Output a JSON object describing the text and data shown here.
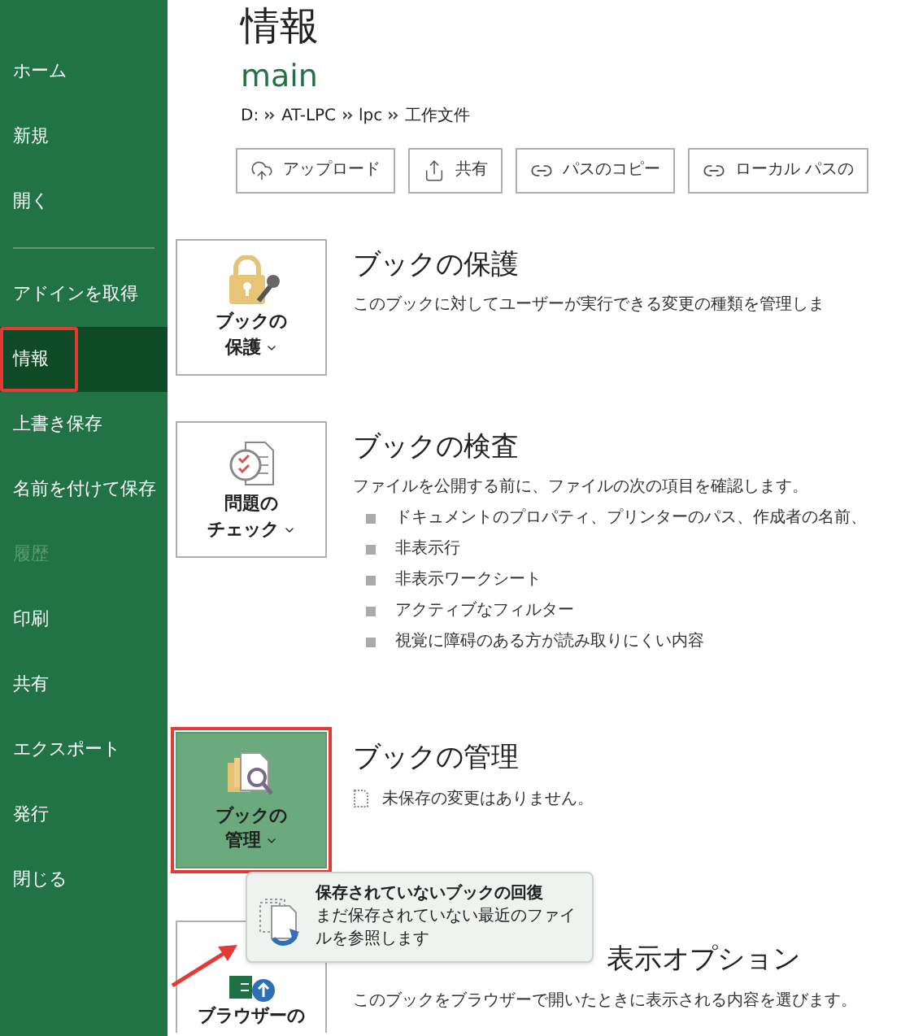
{
  "sidebar": {
    "top_items": [
      {
        "label": "ホーム",
        "selected": false,
        "disabled": false
      },
      {
        "label": "新規",
        "selected": false,
        "disabled": false
      },
      {
        "label": "開く",
        "selected": false,
        "disabled": false
      }
    ],
    "items": [
      {
        "label": "アドインを取得",
        "selected": false,
        "disabled": false,
        "highlighted": false
      },
      {
        "label": "情報",
        "selected": true,
        "disabled": false,
        "highlighted": true
      },
      {
        "label": "上書き保存",
        "selected": false,
        "disabled": false,
        "highlighted": false
      },
      {
        "label": "名前を付けて保存",
        "selected": false,
        "disabled": false,
        "highlighted": false
      },
      {
        "label": "履歴",
        "selected": false,
        "disabled": true,
        "highlighted": false
      },
      {
        "label": "印刷",
        "selected": false,
        "disabled": false,
        "highlighted": false
      },
      {
        "label": "共有",
        "selected": false,
        "disabled": false,
        "highlighted": false
      },
      {
        "label": "エクスポート",
        "selected": false,
        "disabled": false,
        "highlighted": false
      },
      {
        "label": "発行",
        "selected": false,
        "disabled": false,
        "highlighted": false
      },
      {
        "label": "閉じる",
        "selected": false,
        "disabled": false,
        "highlighted": false
      }
    ]
  },
  "page_title": "情報",
  "file": {
    "name": "main",
    "path": [
      "D:",
      "AT-LPC",
      "lpc",
      "工作文件"
    ]
  },
  "actions": [
    {
      "kind": "upload",
      "label": "アップロード"
    },
    {
      "kind": "share",
      "label": "共有"
    },
    {
      "kind": "link",
      "label": "パスのコピー"
    },
    {
      "kind": "link",
      "label": "ローカル パスの"
    }
  ],
  "sections": [
    {
      "kind": "protect",
      "button": [
        "ブックの",
        "保護"
      ],
      "active": false,
      "highlighted": false,
      "title": "ブックの保護",
      "description": "このブックに対してユーザーが実行できる変更の種類を管理しま"
    },
    {
      "kind": "inspect",
      "button": [
        "問題の",
        "チェック"
      ],
      "active": false,
      "highlighted": false,
      "title": "ブックの検査",
      "description": "ファイルを公開する前に、ファイルの次の項目を確認します。",
      "bullets": [
        "ドキュメントのプロパティ、プリンターのパス、作成者の名前、",
        "非表示行",
        "非表示ワークシート",
        "アクティブなフィルター",
        "視覚に障碍のある方が読み取りにくい内容"
      ]
    },
    {
      "kind": "manage",
      "button": [
        "ブックの",
        "管理"
      ],
      "active": true,
      "highlighted": true,
      "title": "ブックの管理",
      "note": "未保存の変更はありません。"
    },
    {
      "kind": "browser",
      "button": [
        "ブラウザーの"
      ],
      "active": false,
      "highlighted": false,
      "title": "表示オプション",
      "description": "このブックをブラウザーで開いたときに表示される内容を選びます。"
    }
  ],
  "popup": {
    "title": "保存されていないブックの回復",
    "description": "まだ保存されていない最近のファイルを参照します"
  },
  "annotation_arrow": true
}
